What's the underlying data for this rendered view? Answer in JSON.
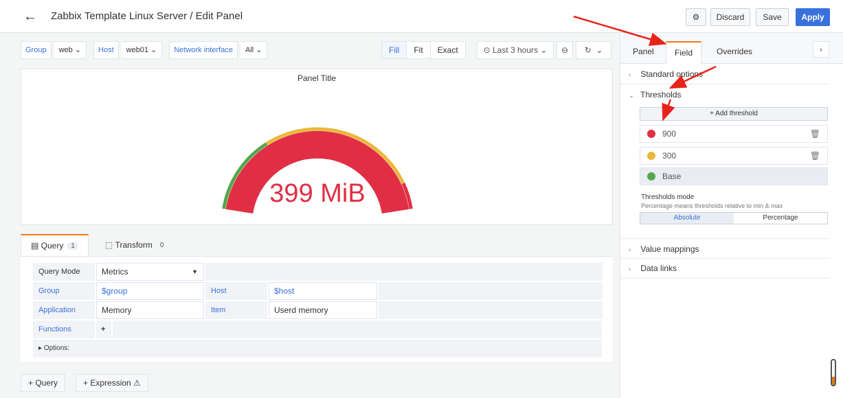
{
  "header": {
    "title": "Zabbix Template Linux Server / Edit Panel",
    "discard": "Discard",
    "save": "Save",
    "apply": "Apply"
  },
  "variables": [
    {
      "label": "Group",
      "value": "web ⌄"
    },
    {
      "label": "Host",
      "value": "web01 ⌄"
    },
    {
      "label": "Network interface",
      "value": "All ⌄"
    }
  ],
  "view_modes": {
    "fill": "Fill",
    "fit": "Fit",
    "exact": "Exact"
  },
  "time_range": "⊙ Last 3 hours  ⌄",
  "panel": {
    "title": "Panel Title",
    "value": "399 MiB",
    "gauge": {
      "value_mb": 399,
      "min": 0,
      "max": 1000,
      "thresholds": [
        300,
        900
      ]
    }
  },
  "query_tabs": {
    "query_label": "Query",
    "query_count": "1",
    "transform_label": "Transform",
    "transform_count": "0"
  },
  "query": {
    "mode_label": "Query Mode",
    "mode_value": "Metrics",
    "group_label": "Group",
    "group_value": "$group",
    "host_label": "Host",
    "host_value": "$host",
    "application_label": "Application",
    "application_value": "Memory",
    "item_label": "Item",
    "item_value": "Userd memory",
    "functions_label": "Functions",
    "functions_add": "+",
    "options_label": "▸ Options:"
  },
  "bottom_buttons": {
    "add_query": "+  Query",
    "add_expression": "+  Expression ⚠"
  },
  "options_pane": {
    "tabs": {
      "panel": "Panel",
      "field": "Field",
      "overrides": "Overrides"
    },
    "standard_options": "Standard options",
    "thresholds": "Thresholds",
    "add_threshold": "+ Add threshold",
    "threshold_items": [
      {
        "value": "900",
        "color": "#e02f44"
      },
      {
        "value": "300",
        "color": "#eab839"
      },
      {
        "value": "Base",
        "color": "#56a64b"
      }
    ],
    "thresholds_mode_title": "Thresholds mode",
    "thresholds_mode_desc": "Percentage means thresholds relative to min & max",
    "mode_absolute": "Absolute",
    "mode_percentage": "Percentage",
    "value_mappings": "Value mappings",
    "data_links": "Data links"
  },
  "colors": {
    "accent": "#3871dc",
    "red": "#e02f44",
    "yellow": "#eab839",
    "green": "#56a64b",
    "tab_active": "#eb7b18"
  }
}
